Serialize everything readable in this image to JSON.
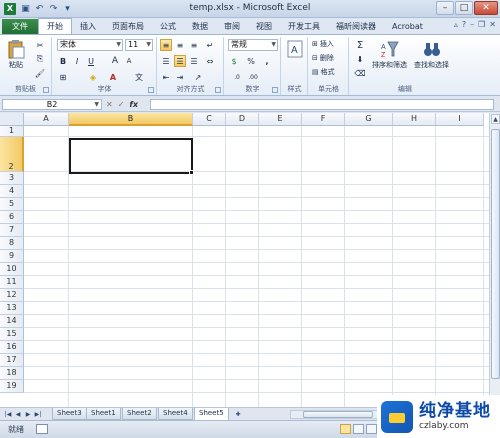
{
  "window": {
    "title": "temp.xlsx - Microsoft Excel",
    "app_icon": "X"
  },
  "tabs": [
    "文件",
    "开始",
    "插入",
    "页面布局",
    "公式",
    "数据",
    "审阅",
    "视图",
    "开发工具",
    "福昕阅读器",
    "Acrobat"
  ],
  "ribbon": {
    "clipboard": {
      "paste": "粘贴",
      "label": "剪贴板"
    },
    "font": {
      "name": "宋体",
      "size": "11",
      "bold": "B",
      "italic": "I",
      "underline": "U",
      "grow": "A",
      "shrink": "A",
      "label": "字体"
    },
    "align": {
      "label": "对齐方式"
    },
    "number": {
      "format": "常规",
      "percent": "%",
      "comma": ",",
      "label": "数字"
    },
    "styles": {
      "label": "样式"
    },
    "cells": {
      "insert": "插入",
      "delete": "删除",
      "format": "格式",
      "label": "单元格"
    },
    "editing": {
      "sort": "排序和筛选",
      "find": "查找和选择",
      "sum": "Σ",
      "label": "编辑"
    }
  },
  "formula_bar": {
    "name_box": "B2",
    "fx": "fx",
    "value": ""
  },
  "columns": [
    "A",
    "B",
    "C",
    "D",
    "E",
    "F",
    "G",
    "H",
    "I"
  ],
  "rows": [
    "1",
    "2",
    "3",
    "4",
    "5",
    "6",
    "7",
    "8",
    "9",
    "10",
    "11",
    "12",
    "13",
    "14",
    "15",
    "16",
    "17",
    "18",
    "19"
  ],
  "selected": {
    "col": "B",
    "row": "2"
  },
  "sheets": [
    "Sheet3",
    "Sheet1",
    "Sheet2",
    "Sheet4",
    "Sheet5"
  ],
  "active_sheet": "Sheet5",
  "status": {
    "text": "就绪"
  },
  "watermark": {
    "main": "纯净基地",
    "sub": "czlaby.com"
  }
}
